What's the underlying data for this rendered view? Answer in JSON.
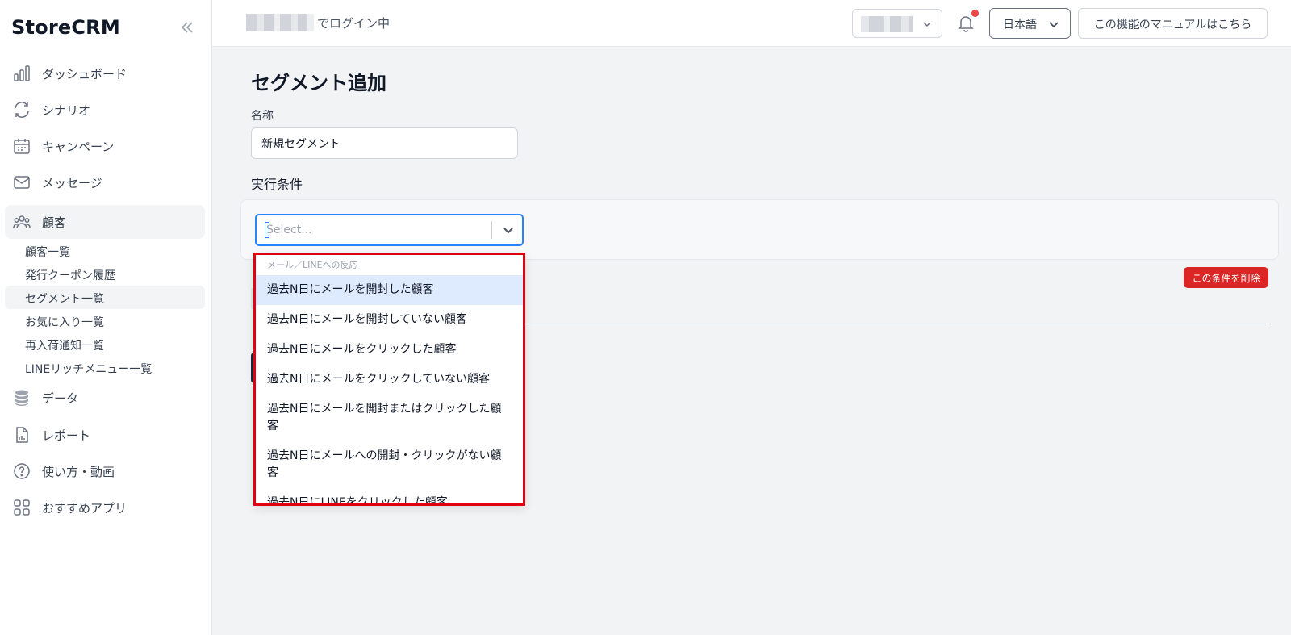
{
  "sidebar": {
    "logo": "StoreCRM",
    "nav": [
      {
        "label": "ダッシュボード",
        "icon": "bar-chart-icon"
      },
      {
        "label": "シナリオ",
        "icon": "refresh-icon"
      },
      {
        "label": "キャンペーン",
        "icon": "calendar-icon"
      },
      {
        "label": "メッセージ",
        "icon": "mail-icon"
      },
      {
        "label": "顧客",
        "icon": "users-icon"
      },
      {
        "label": "データ",
        "icon": "database-icon"
      },
      {
        "label": "レポート",
        "icon": "report-icon"
      },
      {
        "label": "使い方・動画",
        "icon": "help-icon"
      },
      {
        "label": "おすすめアプリ",
        "icon": "apps-icon"
      }
    ],
    "customer_sub": [
      {
        "label": "顧客一覧"
      },
      {
        "label": "発行クーポン履歴"
      },
      {
        "label": "セグメント一覧"
      },
      {
        "label": "お気に入り一覧"
      },
      {
        "label": "再入荷通知一覧"
      },
      {
        "label": "LINEリッチメニュー一覧"
      }
    ]
  },
  "header": {
    "login_text": "でログイン中",
    "language": "日本語",
    "manual_button": "この機能のマニュアルはこちら"
  },
  "main": {
    "title": "セグメント追加",
    "name_label": "名称",
    "name_value": "新規セグメント",
    "condition_label": "実行条件",
    "select_placeholder": "Select...",
    "delete_button": "この条件を削除"
  },
  "dropdown": {
    "group_label": "メール／LINEへの反応",
    "options": [
      "過去N日にメールを開封した顧客",
      "過去N日にメールを開封していない顧客",
      "過去N日にメールをクリックした顧客",
      "過去N日にメールをクリックしていない顧客",
      "過去N日にメールを開封またはクリックした顧客",
      "過去N日にメールへの開封・クリックがない顧客",
      "過去N日にLINEをクリックした顧客"
    ]
  },
  "colors": {
    "highlight_border": "#e3000f",
    "focus_blue": "#2684ff",
    "delete_red": "#dc2626",
    "notification_dot": "#ef4444"
  }
}
